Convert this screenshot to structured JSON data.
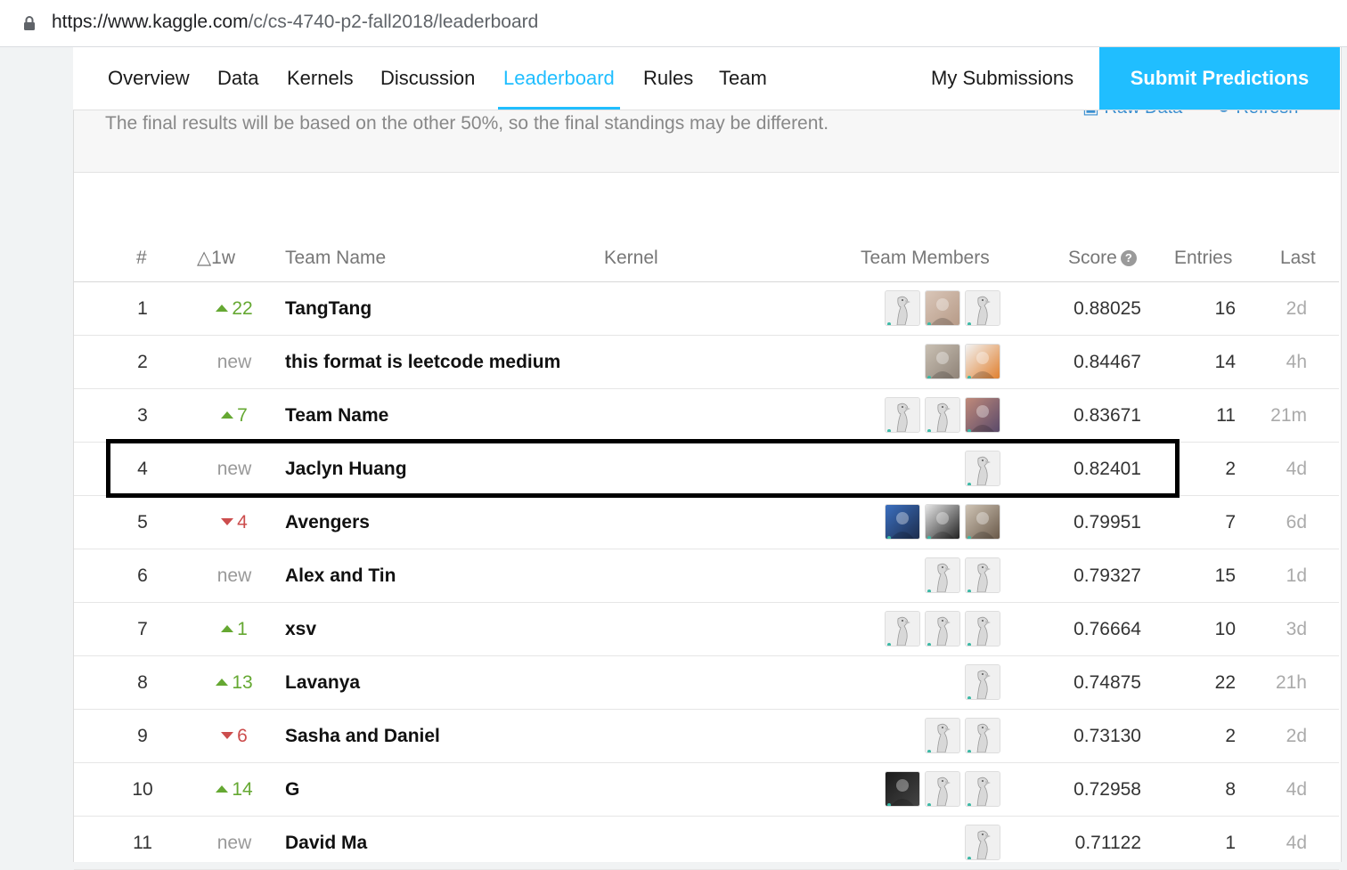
{
  "browser": {
    "url_host": "https://www.kaggle.com",
    "url_path": "/c/cs-4740-p2-fall2018/leaderboard"
  },
  "tabs": [
    {
      "label": "Overview"
    },
    {
      "label": "Data"
    },
    {
      "label": "Kernels"
    },
    {
      "label": "Discussion"
    },
    {
      "label": "Leaderboard",
      "active": true
    },
    {
      "label": "Rules"
    },
    {
      "label": "Team"
    }
  ],
  "my_submissions_label": "My Submissions",
  "submit_label": "Submit Predictions",
  "notice": "The final results will be based on the other 50%, so the final standings may be different.",
  "raw_data_label": "Raw Data",
  "refresh_label": "Refresh",
  "columns": {
    "rank": "#",
    "delta": "△1w",
    "team_name": "Team Name",
    "kernel": "Kernel",
    "team_members": "Team Members",
    "score": "Score",
    "entries": "Entries",
    "last": "Last"
  },
  "colors": {
    "accent": "#20beff",
    "up": "#65a832",
    "down": "#cc4d4d"
  },
  "rows": [
    {
      "rank": "1",
      "delta": "22",
      "dir": "up",
      "team": "TangTang",
      "members": [
        "default",
        "photo-cat",
        "default"
      ],
      "score": "0.88025",
      "entries": "16",
      "last": "2d"
    },
    {
      "rank": "2",
      "delta": "new",
      "dir": "new",
      "team": "this format is leetcode medium",
      "members": [
        "photo-elder",
        "photo-carrot"
      ],
      "score": "0.84467",
      "entries": "14",
      "last": "4h"
    },
    {
      "rank": "3",
      "delta": "7",
      "dir": "up",
      "team": "Team Name",
      "members": [
        "default",
        "default",
        "photo-landscape"
      ],
      "score": "0.83671",
      "entries": "11",
      "last": "21m"
    },
    {
      "rank": "4",
      "delta": "new",
      "dir": "new",
      "team": "Jaclyn Huang",
      "members": [
        "default"
      ],
      "score": "0.82401",
      "entries": "2",
      "last": "4d"
    },
    {
      "rank": "5",
      "delta": "4",
      "dir": "down",
      "team": "Avengers",
      "members": [
        "photo-blue",
        "photo-bw",
        "photo-person"
      ],
      "score": "0.79951",
      "entries": "7",
      "last": "6d"
    },
    {
      "rank": "6",
      "delta": "new",
      "dir": "new",
      "team": "Alex and Tin",
      "members": [
        "default",
        "default"
      ],
      "score": "0.79327",
      "entries": "15",
      "last": "1d"
    },
    {
      "rank": "7",
      "delta": "1",
      "dir": "up",
      "team": "xsv",
      "members": [
        "default",
        "default",
        "default"
      ],
      "score": "0.76664",
      "entries": "10",
      "last": "3d"
    },
    {
      "rank": "8",
      "delta": "13",
      "dir": "up",
      "team": "Lavanya",
      "members": [
        "default"
      ],
      "score": "0.74875",
      "entries": "22",
      "last": "21h"
    },
    {
      "rank": "9",
      "delta": "6",
      "dir": "down",
      "team": "Sasha and Daniel",
      "members": [
        "default",
        "default"
      ],
      "score": "0.73130",
      "entries": "2",
      "last": "2d"
    },
    {
      "rank": "10",
      "delta": "14",
      "dir": "up",
      "team": "G",
      "members": [
        "photo-dark",
        "default",
        "default"
      ],
      "score": "0.72958",
      "entries": "8",
      "last": "4d"
    },
    {
      "rank": "11",
      "delta": "new",
      "dir": "new",
      "team": "David Ma",
      "members": [
        "default"
      ],
      "score": "0.71122",
      "entries": "1",
      "last": "4d"
    }
  ]
}
